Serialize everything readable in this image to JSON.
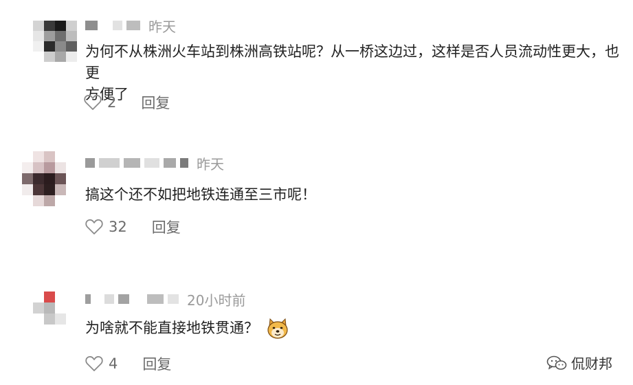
{
  "comments": [
    {
      "time": "昨天",
      "text_line1": "为何不从株洲火车站到株洲高铁站呢？从一桥这边过，这样是否人员流动性更大，也更",
      "text_line2": "方便了",
      "like_count": "2",
      "reply_label": "回复"
    },
    {
      "time": "昨天",
      "text": "搞这个还不如把地铁连通至三市呢！",
      "like_count": "32",
      "reply_label": "回复"
    },
    {
      "time": "20小时前",
      "text": "为啥就不能直接地铁贯通？",
      "like_count": "4",
      "reply_label": "回复"
    }
  ],
  "watermark": {
    "label": "侃财邦"
  },
  "icons": {
    "like": "heart-outline-icon",
    "emoji": "doge-emoji-icon",
    "watermark": "wechat-official-account-icon"
  }
}
